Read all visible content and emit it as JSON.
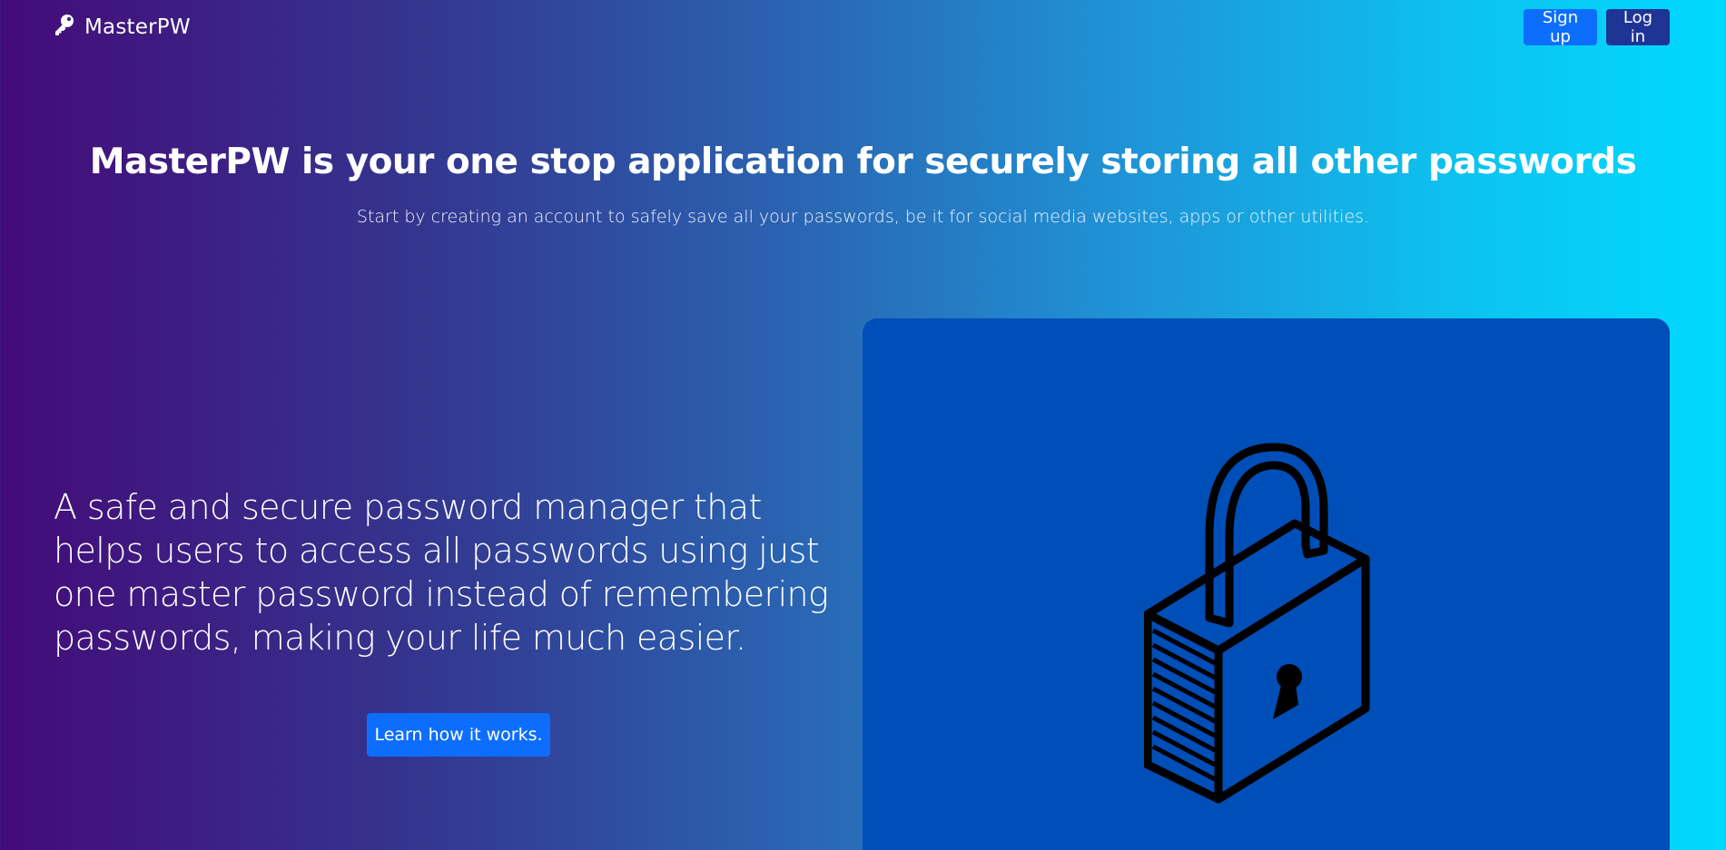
{
  "navbar": {
    "brand": "MasterPW",
    "brand_icon": "key-icon",
    "signup_label": "Sign up",
    "login_label": "Log in"
  },
  "hero": {
    "title": "MasterPW is your one stop application for securely storing all other passwords",
    "subtitle": "Start by creating an account to safely save all your passwords, be it for social media websites, apps or other utilities."
  },
  "feature": {
    "lead": "A safe and secure password manager that helps users to access all passwords using just one master password instead of remembering passwords, making your life much easier.",
    "cta_label": "Learn how it works.",
    "image_icon": "padlock-icon"
  },
  "colors": {
    "gradient_start": "#440b78",
    "gradient_end": "#00d9ff",
    "primary_button": "#0d6efd",
    "login_button": "#1f3596",
    "image_panel": "#004eb8"
  }
}
